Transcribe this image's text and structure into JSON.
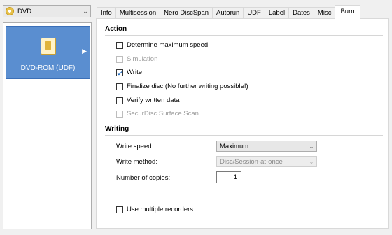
{
  "disc_select": {
    "value": "DVD",
    "icon": "disc-icon"
  },
  "project": {
    "label": "DVD-ROM (UDF)",
    "icon": "project-file-icon"
  },
  "tabs": [
    {
      "label": "Info"
    },
    {
      "label": "Multisession"
    },
    {
      "label": "Nero DiscSpan"
    },
    {
      "label": "Autorun"
    },
    {
      "label": "UDF"
    },
    {
      "label": "Label"
    },
    {
      "label": "Dates"
    },
    {
      "label": "Misc"
    },
    {
      "label": "Burn"
    }
  ],
  "active_tab": "Burn",
  "action": {
    "title": "Action",
    "options": [
      {
        "label": "Determine maximum speed",
        "checked": false,
        "enabled": true
      },
      {
        "label": "Simulation",
        "checked": false,
        "enabled": false
      },
      {
        "label": "Write",
        "checked": true,
        "enabled": true
      },
      {
        "label": "Finalize disc (No further writing possible!)",
        "checked": false,
        "enabled": true
      },
      {
        "label": "Verify written data",
        "checked": false,
        "enabled": true
      },
      {
        "label": "SecurDisc Surface Scan",
        "checked": false,
        "enabled": false
      }
    ]
  },
  "writing": {
    "title": "Writing",
    "write_speed_label": "Write speed:",
    "write_speed_value": "Maximum",
    "write_method_label": "Write method:",
    "write_method_value": "Disc/Session-at-once",
    "copies_label": "Number of copies:",
    "copies_value": "1",
    "multiple_recorders_label": "Use multiple recorders",
    "multiple_recorders_checked": false
  },
  "colors": {
    "tile_bg": "#5a8ed0",
    "accent": "#0a5bb5"
  }
}
